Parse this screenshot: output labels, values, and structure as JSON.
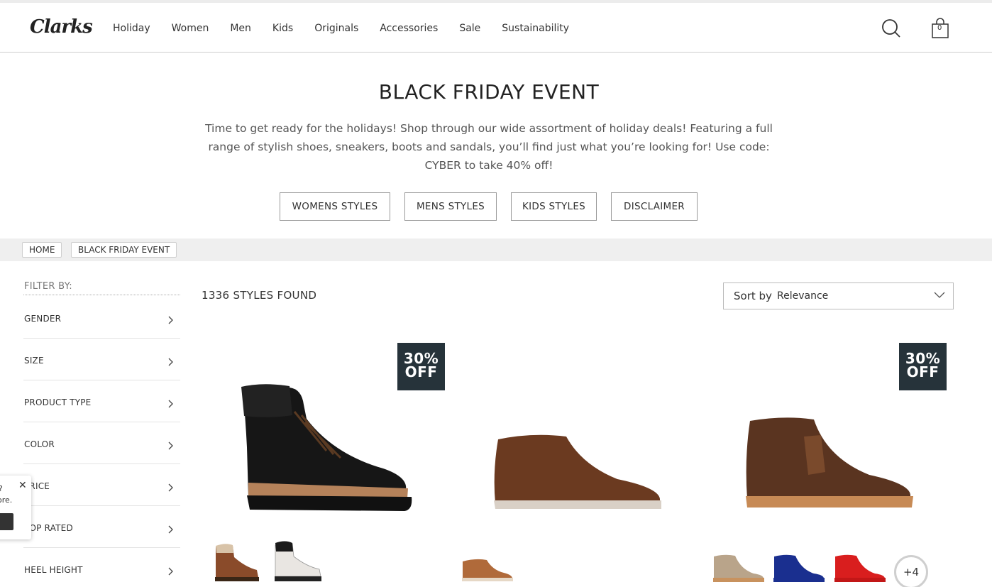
{
  "header": {
    "logo": "Clarks",
    "nav": [
      "Holiday",
      "Women",
      "Men",
      "Kids",
      "Originals",
      "Accessories",
      "Sale",
      "Sustainability"
    ],
    "bag_count": "0"
  },
  "hero": {
    "title": "BLACK FRIDAY EVENT",
    "text": "Time to get ready for the holidays! Shop through our wide assortment of holiday deals! Featuring a full range of stylish shoes, sneakers, boots and sandals, you’ll find just what you’re looking for! Use code: CYBER to take 40% off!",
    "buttons": [
      "WOMENS STYLES",
      "MENS STYLES",
      "KIDS STYLES",
      "DISCLAIMER"
    ]
  },
  "breadcrumb": [
    "HOME",
    "BLACK FRIDAY EVENT"
  ],
  "filters": {
    "title": "FILTER BY:",
    "items": [
      "GENDER",
      "SIZE",
      "PRODUCT TYPE",
      "COLOR",
      "PRICE",
      "TOP RATED",
      "HEEL HEIGHT"
    ]
  },
  "results": {
    "count": "1336 STYLES FOUND",
    "sort_label": "Sort by",
    "sort_value": "Relevance"
  },
  "products": [
    {
      "badge_line1": "30%",
      "badge_line2": "OFF",
      "color": "black croc leather boot",
      "swatches": [
        "brown",
        "white"
      ]
    },
    {
      "badge_line1": "",
      "badge_line2": "",
      "color": "brown suede chukka",
      "swatches": [
        "tan"
      ]
    },
    {
      "badge_line1": "30%",
      "badge_line2": "OFF",
      "color": "dark brown leather desert boot",
      "swatches": [
        "sand",
        "blue",
        "red"
      ],
      "more": "+4"
    }
  ],
  "popup": {
    "line1": "?",
    "line2": "ore."
  },
  "colors": {
    "badge": "#26333a",
    "crumb_bar": "#efefef"
  }
}
